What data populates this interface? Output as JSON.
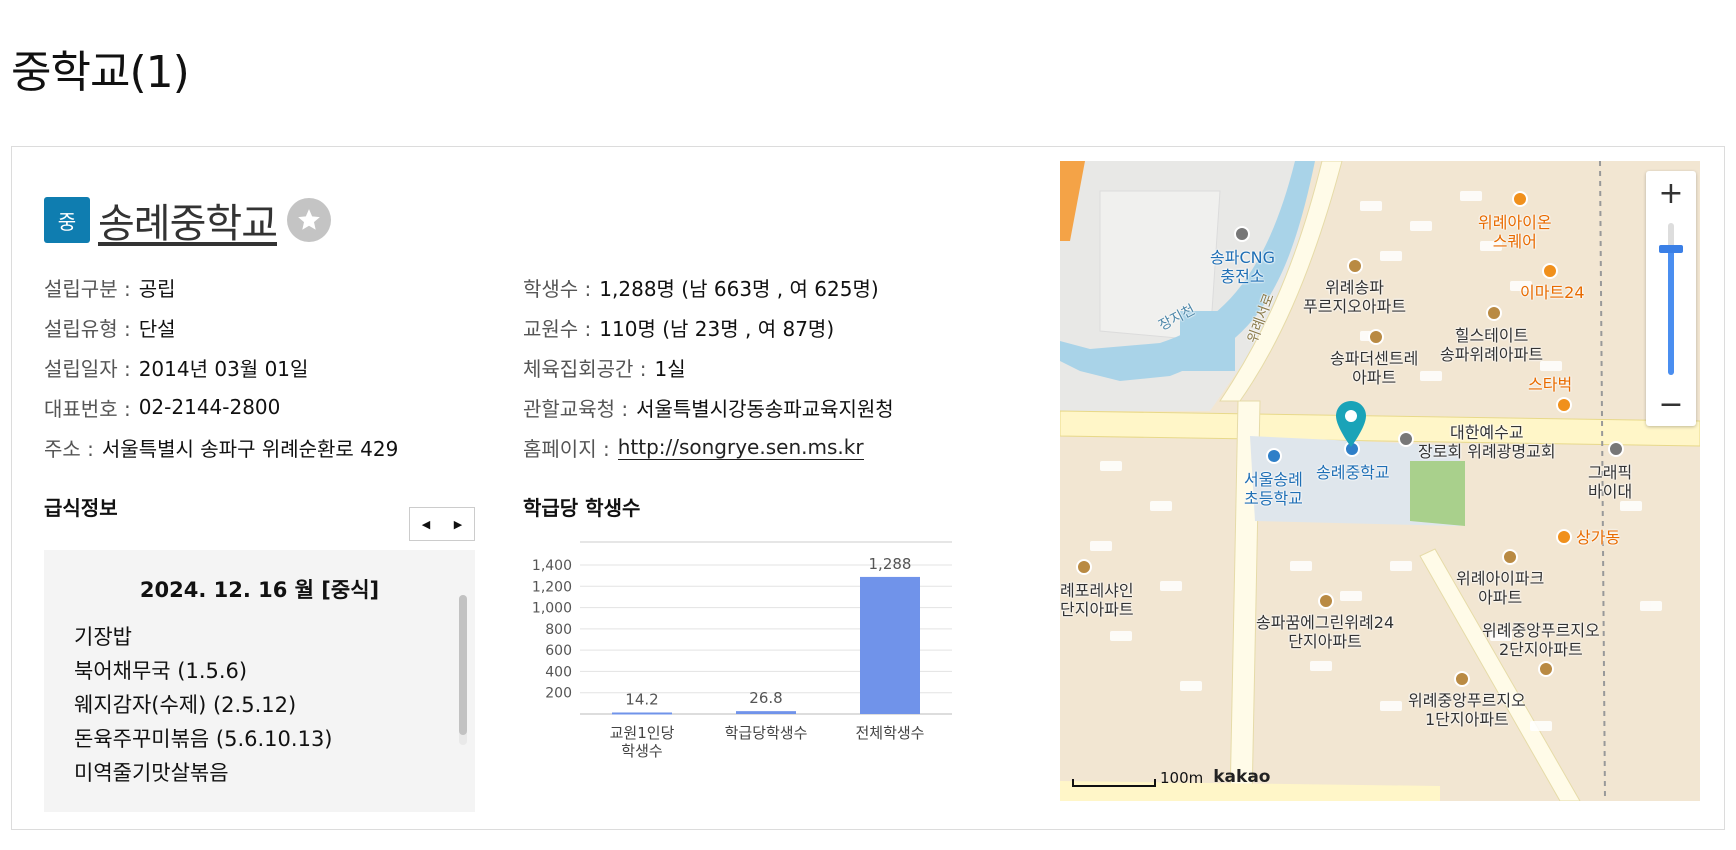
{
  "page": {
    "heading": "중학교(1)"
  },
  "school": {
    "badge": "중",
    "name": "송례중학교",
    "favorite_icon": "star-icon"
  },
  "info_left": [
    {
      "key": "설립구분 :",
      "value": "공립"
    },
    {
      "key": "설립유형 :",
      "value": "단설"
    },
    {
      "key": "설립일자 :",
      "value": "2014년 03월 01일"
    },
    {
      "key": "대표번호 :",
      "value": "02-2144-2800"
    },
    {
      "key": "주소 :",
      "value": "서울특별시 송파구 위례순환로 429"
    }
  ],
  "info_right": [
    {
      "key": "학생수 :",
      "value": "1,288명 (남 663명 , 여 625명)"
    },
    {
      "key": "교원수 :",
      "value": "110명 (남 23명 , 여 87명)"
    },
    {
      "key": "체육집회공간 :",
      "value": "1실"
    },
    {
      "key": "관할교육청 :",
      "value": "서울특별시강동송파교육지원청"
    },
    {
      "key": "홈페이지 :",
      "value": "http://songrye.sen.ms.kr"
    }
  ],
  "meal": {
    "title": "급식정보",
    "prev_icon": "triangle-left-icon",
    "next_icon": "triangle-right-icon",
    "prev_glyph": "◀",
    "next_glyph": "▶",
    "date": "2024. 12. 16 월 [중식]",
    "items": [
      "기장밥",
      "북어채무국 (1.5.6)",
      "웨지감자(수제) (2.5.12)",
      "돈육주꾸미볶음 (5.6.10.13)",
      "미역줄기맛살볶음"
    ]
  },
  "chart_title": "학급당 학생수",
  "chart_data": {
    "type": "bar",
    "categories": [
      "교원1인당\n학생수",
      "학급당학생수",
      "전체학생수"
    ],
    "values": [
      14.2,
      26.8,
      1288
    ],
    "value_labels": [
      "14.2",
      "26.8",
      "1,288"
    ],
    "y_ticks": [
      "200",
      "400",
      "600",
      "800",
      "1,000",
      "1,200",
      "1,400"
    ],
    "y_tick_values": [
      200,
      400,
      600,
      800,
      1000,
      1200,
      1400
    ],
    "ylim": [
      0,
      1400
    ],
    "bar_color": "#7093ea",
    "grid": true
  },
  "map": {
    "zoom_in": "+",
    "zoom_out": "−",
    "zoom_level": 0.83,
    "scale": "100m",
    "brand": "kakao",
    "labels": {
      "lotte": "위례아이온\n스퀘어",
      "emart": "이마트24",
      "starbucks": "스타벅",
      "cng": "송파CNG\n충전소",
      "apt1": "위례송파\n푸르지오아파트",
      "hill": "힐스테이트\n송파위례아파트",
      "center": "송파더센트레\n아파트",
      "church": "대한예수교\n장로회 위례광명교회",
      "elem": "서울송례\n초등학교",
      "school": "송례중학교",
      "graphic": "그래픽\n바이대",
      "shop": "상가동",
      "ipark": "위례아이파크\n아파트",
      "prelle": "례포레샤인\n단지아파트",
      "kkum": "송파꿈에그린위례24\n단지아파트",
      "jungang2": "위례중앙푸르지오\n2단지아파트",
      "jungang1": "위례중앙푸르지오\n1단지아파트",
      "road1": "위례서로",
      "river": "장지천"
    }
  }
}
